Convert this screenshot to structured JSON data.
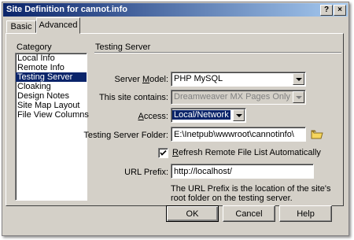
{
  "window": {
    "title": "Site Definition for cannot.info",
    "help_btn": "?",
    "close_btn": "×"
  },
  "tabs": [
    {
      "label": "Basic",
      "active": false
    },
    {
      "label": "Advanced",
      "active": true
    }
  ],
  "category": {
    "label": "Category",
    "items": [
      "Local Info",
      "Remote Info",
      "Testing Server",
      "Cloaking",
      "Design Notes",
      "Site Map Layout",
      "File View Columns"
    ],
    "selected": "Testing Server"
  },
  "section_title": "Testing Server",
  "form": {
    "server_model": {
      "label_pre": "Server ",
      "label_u": "M",
      "label_post": "odel:",
      "value": "PHP MySQL"
    },
    "site_contains": {
      "label": "This site contains:",
      "value": "Dreamweaver MX Pages Only"
    },
    "access": {
      "label_pre": "",
      "label_u": "A",
      "label_post": "ccess:",
      "value": "Local/Network"
    },
    "folder": {
      "label": "Testing Server Folder:",
      "value": "E:\\Inetpub\\wwwroot\\cannotinfo\\"
    },
    "refresh": {
      "label_pre": "",
      "label_u": "R",
      "label_post": "efresh Remote File List Automatically",
      "checked": true
    },
    "url_prefix": {
      "label": "URL Prefix:",
      "value": "http://localhost/"
    },
    "url_note": [
      "The URL Prefix is the location of the site's",
      "root folder on the testing server."
    ]
  },
  "buttons": {
    "ok": "OK",
    "cancel": "Cancel",
    "help": "Help"
  },
  "colors": {
    "face": "#d4d0c8",
    "selection": "#0a246a",
    "title_start": "#0a246a",
    "title_end": "#a6caf0"
  },
  "icons": {
    "folder": "folder-icon",
    "checkmark": "checkmark-icon"
  }
}
